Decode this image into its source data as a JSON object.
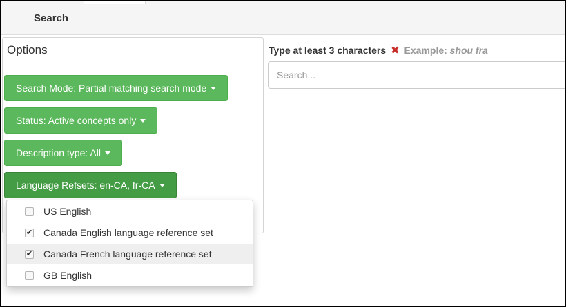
{
  "header": {
    "tab_label": "Search"
  },
  "options": {
    "title": "Options",
    "search_mode_label": "Search Mode: Partial matching search mode",
    "status_label": "Status: Active concepts only",
    "description_type_label": "Description type: All",
    "language_refsets_label": "Language Refsets: en-CA, fr-CA"
  },
  "language_dropdown": {
    "items": [
      {
        "label": "US English",
        "checked": false,
        "check_glyph": ""
      },
      {
        "label": "Canada English language reference set",
        "checked": true,
        "check_glyph": "✔"
      },
      {
        "label": "Canada French language reference set",
        "checked": true,
        "check_glyph": "✔"
      },
      {
        "label": "GB English",
        "checked": false,
        "check_glyph": ""
      }
    ]
  },
  "search": {
    "hint_text": "Type at least 3 characters",
    "hint_x": "✖",
    "example_label": "Example:",
    "example_value": "shou fra",
    "placeholder": "Search..."
  },
  "colors": {
    "button_green": "#5cb85c",
    "button_green_active": "#449d44",
    "error_red": "#c9302c"
  }
}
